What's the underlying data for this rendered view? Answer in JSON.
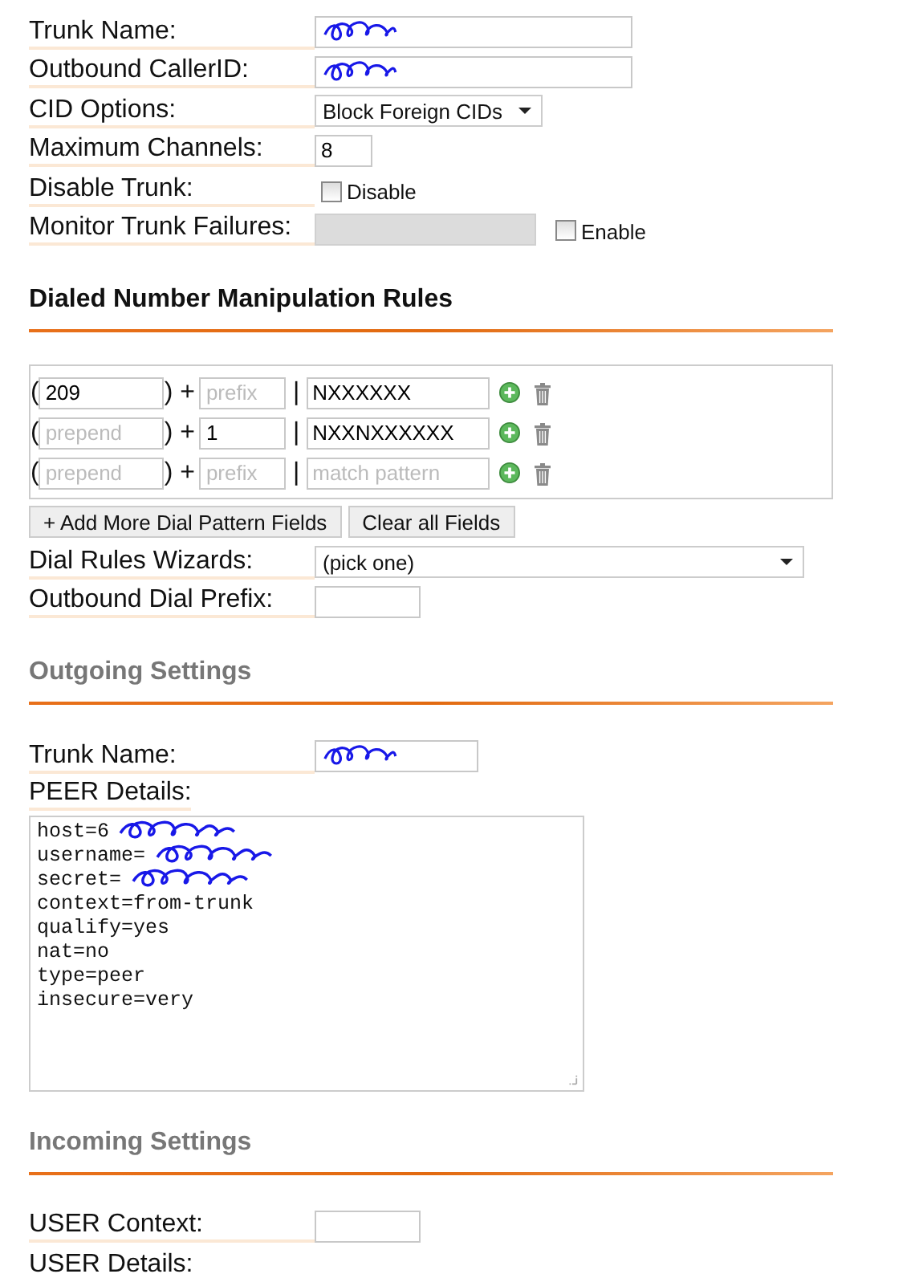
{
  "general": [
    {
      "kind": "text",
      "label": "Trunk Name:",
      "redacted": true
    },
    {
      "kind": "text",
      "label": "Outbound CallerID:",
      "redacted": true
    },
    {
      "kind": "select",
      "label": "CID Options:",
      "value": "Block Foreign CIDs"
    },
    {
      "kind": "tiny-text",
      "label": "Maximum Channels:",
      "value": "8"
    },
    {
      "kind": "checkbox",
      "label": "Disable Trunk:",
      "checkbox": {
        "label": "Disable",
        "checked": false
      }
    },
    {
      "kind": "text-with-checkbox",
      "label": "Monitor Trunk Failures:",
      "disabled": true,
      "checkbox": {
        "label": "Enable",
        "checked": false
      }
    }
  ],
  "dial_rules": {
    "title": "Dialed Number Manipulation Rules",
    "rows": [
      {
        "prepend": {
          "value": "209"
        },
        "prefix": {
          "placeholder": "prefix"
        },
        "pattern": {
          "value": "NXXXXXX"
        }
      },
      {
        "prepend": {
          "placeholder": "prepend"
        },
        "prefix": {
          "value": "1"
        },
        "pattern": {
          "value": "NXXNXXXXXX"
        }
      },
      {
        "prepend": {
          "placeholder": "prepend"
        },
        "prefix": {
          "placeholder": "prefix"
        },
        "pattern": {
          "placeholder": "match pattern"
        }
      }
    ],
    "symbols": {
      "open": "(",
      "plus": ") +",
      "bar": "|"
    },
    "buttons": [
      "+ Add More Dial Pattern Fields",
      "Clear all Fields"
    ],
    "fields": [
      {
        "kind": "wide-select",
        "label": "Dial Rules Wizards:",
        "value": "(pick one)"
      },
      {
        "kind": "short-text",
        "label": "Outbound Dial Prefix:"
      }
    ]
  },
  "outgoing": {
    "title": "Outgoing Settings",
    "fields": [
      {
        "kind": "medium-text",
        "label": "Trunk Name:",
        "redacted": true
      },
      {
        "kind": "textarea",
        "label": "PEER Details:",
        "lines": [
          {
            "text": "host=6",
            "redacted": true
          },
          {
            "text": "username=",
            "redacted": true
          },
          {
            "text": "secret=",
            "redacted": true
          },
          {
            "text": "context=from-trunk",
            "redacted": false
          },
          {
            "text": "qualify=yes",
            "redacted": false
          },
          {
            "text": "nat=no",
            "redacted": false
          },
          {
            "text": "type=peer",
            "redacted": false
          },
          {
            "text": "insecure=very",
            "redacted": false
          }
        ]
      }
    ]
  },
  "incoming": {
    "title": "Incoming Settings",
    "fields": [
      {
        "kind": "short-text",
        "label": "USER Context:"
      },
      {
        "kind": "label-only",
        "label": "USER Details:"
      }
    ]
  }
}
